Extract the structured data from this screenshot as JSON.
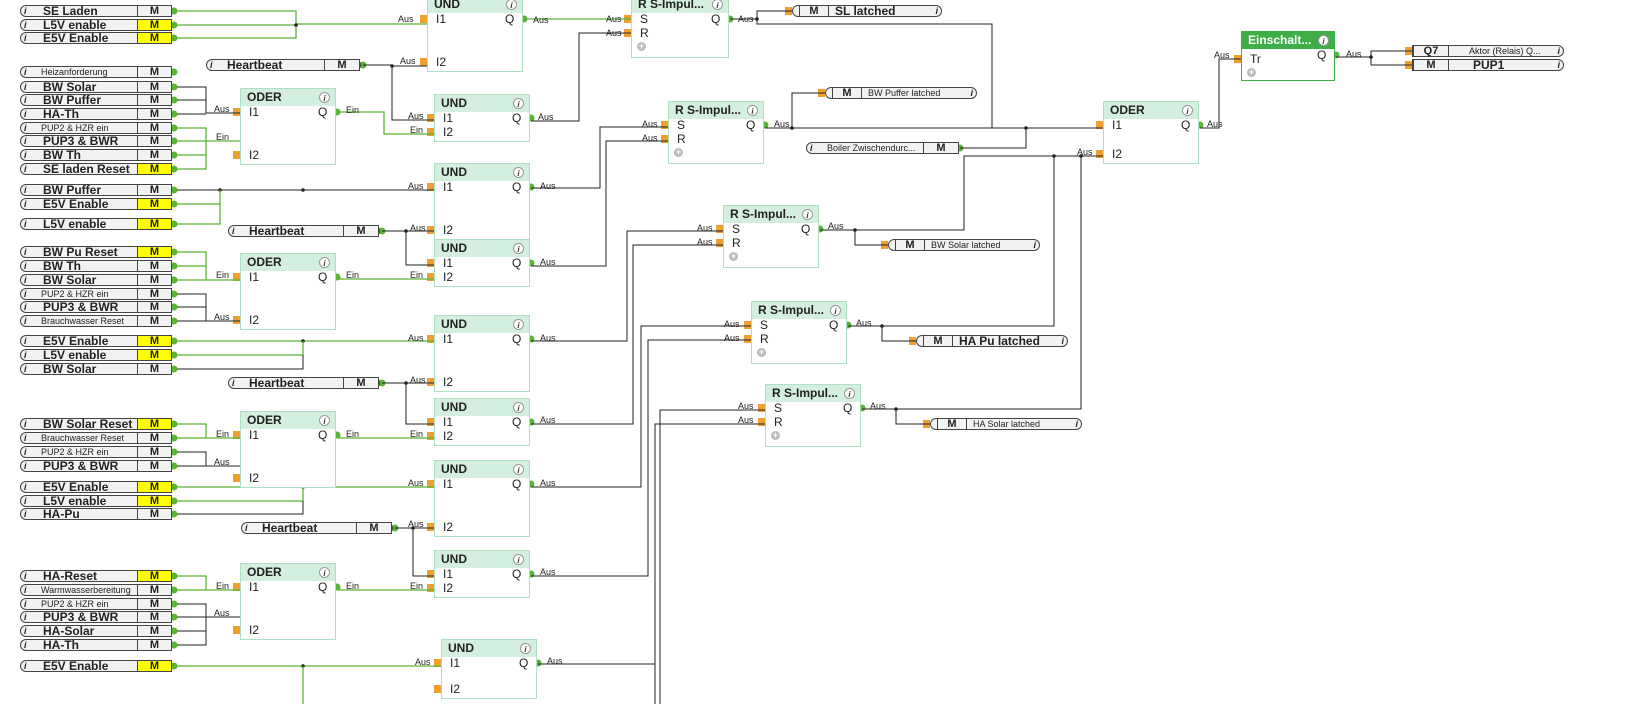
{
  "colors": {
    "green_wire": "#5ab535",
    "black_wire": "#222222",
    "block_header": "#d4efdf",
    "block_border": "#aee0c4",
    "active_block": "#3fae49",
    "memory_highlight": "#ffff00",
    "port_in": "#f0a030"
  },
  "labels": {
    "aus": "Aus",
    "ein": "Ein",
    "q": "Q",
    "m": "M",
    "i1": "I1",
    "i2": "I2",
    "s": "S",
    "r": "R",
    "tr": "Tr",
    "info": "i",
    "add": "+"
  },
  "memories": [
    {
      "name": "SE Laden",
      "small": false,
      "highlight": false
    },
    {
      "name": "L5V enable",
      "small": false,
      "highlight": true
    },
    {
      "name": "E5V Enable",
      "small": false,
      "highlight": true
    },
    {
      "name": "Heizanforderung",
      "small": true,
      "highlight": false
    },
    {
      "name": "BW Solar",
      "small": false,
      "highlight": false
    },
    {
      "name": "BW Puffer",
      "small": false,
      "highlight": false
    },
    {
      "name": "HA-Th",
      "small": false,
      "highlight": false
    },
    {
      "name": "PUP2 & HZR ein",
      "small": true,
      "highlight": false
    },
    {
      "name": "PUP3 & BWR",
      "small": false,
      "highlight": false
    },
    {
      "name": "BW Th",
      "small": false,
      "highlight": false
    },
    {
      "name": "SE laden Reset",
      "small": false,
      "highlight": true
    },
    {
      "name": "BW Puffer",
      "small": false,
      "highlight": false
    },
    {
      "name": "E5V Enable",
      "small": false,
      "highlight": true
    },
    {
      "name": "L5V enable",
      "small": false,
      "highlight": true
    },
    {
      "name": "BW Pu Reset",
      "small": false,
      "highlight": true
    },
    {
      "name": "BW Th",
      "small": false,
      "highlight": false
    },
    {
      "name": "BW Solar",
      "small": false,
      "highlight": false
    },
    {
      "name": "PUP2 & HZR ein",
      "small": true,
      "highlight": false
    },
    {
      "name": "PUP3 & BWR",
      "small": false,
      "highlight": false
    },
    {
      "name": "Brauchwasser Reset",
      "small": true,
      "highlight": false
    },
    {
      "name": "E5V Enable",
      "small": false,
      "highlight": true
    },
    {
      "name": "L5V enable",
      "small": false,
      "highlight": true
    },
    {
      "name": "BW Solar",
      "small": false,
      "highlight": false
    },
    {
      "name": "BW Solar Reset",
      "small": false,
      "highlight": true
    },
    {
      "name": "Brauchwasser Reset",
      "small": true,
      "highlight": false
    },
    {
      "name": "PUP2 & HZR ein",
      "small": true,
      "highlight": false
    },
    {
      "name": "PUP3 & BWR",
      "small": false,
      "highlight": false
    },
    {
      "name": "E5V Enable",
      "small": false,
      "highlight": true
    },
    {
      "name": "L5V enable",
      "small": false,
      "highlight": true
    },
    {
      "name": "HA-Pu",
      "small": false,
      "highlight": false
    },
    {
      "name": "HA-Reset",
      "small": false,
      "highlight": true
    },
    {
      "name": "Warmwasserbereitung",
      "small": true,
      "highlight": false
    },
    {
      "name": "PUP2 & HZR ein",
      "small": true,
      "highlight": false
    },
    {
      "name": "PUP3 & BWR",
      "small": false,
      "highlight": false
    },
    {
      "name": "HA-Solar",
      "small": false,
      "highlight": false
    },
    {
      "name": "HA-Th",
      "small": false,
      "highlight": false
    },
    {
      "name": "E5V Enable",
      "small": false,
      "highlight": true
    }
  ],
  "heartbeats": [
    {
      "name": "Heartbeat"
    },
    {
      "name": "Heartbeat"
    },
    {
      "name": "Heartbeat"
    },
    {
      "name": "Heartbeat"
    }
  ],
  "mid_memories": [
    {
      "name": "Boiler Zwischendurc...",
      "small": true
    }
  ],
  "latched": [
    {
      "name": "SL latched",
      "small": false
    },
    {
      "name": "BW Puffer latched",
      "small": true
    },
    {
      "name": "BW Solar latched",
      "small": true
    },
    {
      "name": "HA Pu latched",
      "small": false
    },
    {
      "name": "HA Solar latched",
      "small": true
    }
  ],
  "blocks": [
    {
      "title": "UND"
    },
    {
      "title": "UND"
    },
    {
      "title": "UND"
    },
    {
      "title": "UND"
    },
    {
      "title": "UND"
    },
    {
      "title": "UND"
    },
    {
      "title": "UND"
    },
    {
      "title": "UND"
    },
    {
      "title": "UND"
    },
    {
      "title": "ODER"
    },
    {
      "title": "ODER"
    },
    {
      "title": "ODER"
    },
    {
      "title": "ODER"
    },
    {
      "title": "R S-Impul..."
    },
    {
      "title": "R S-Impul..."
    },
    {
      "title": "R S-Impul..."
    },
    {
      "title": "R S-Impul..."
    },
    {
      "title": "R S-Impul..."
    },
    {
      "title": "ODER"
    },
    {
      "title": "Einschalt..."
    }
  ],
  "outputs": [
    {
      "code": "Q7",
      "name": "Aktor (Relais) Q..."
    },
    {
      "code": "M",
      "name": "PUP1"
    }
  ]
}
